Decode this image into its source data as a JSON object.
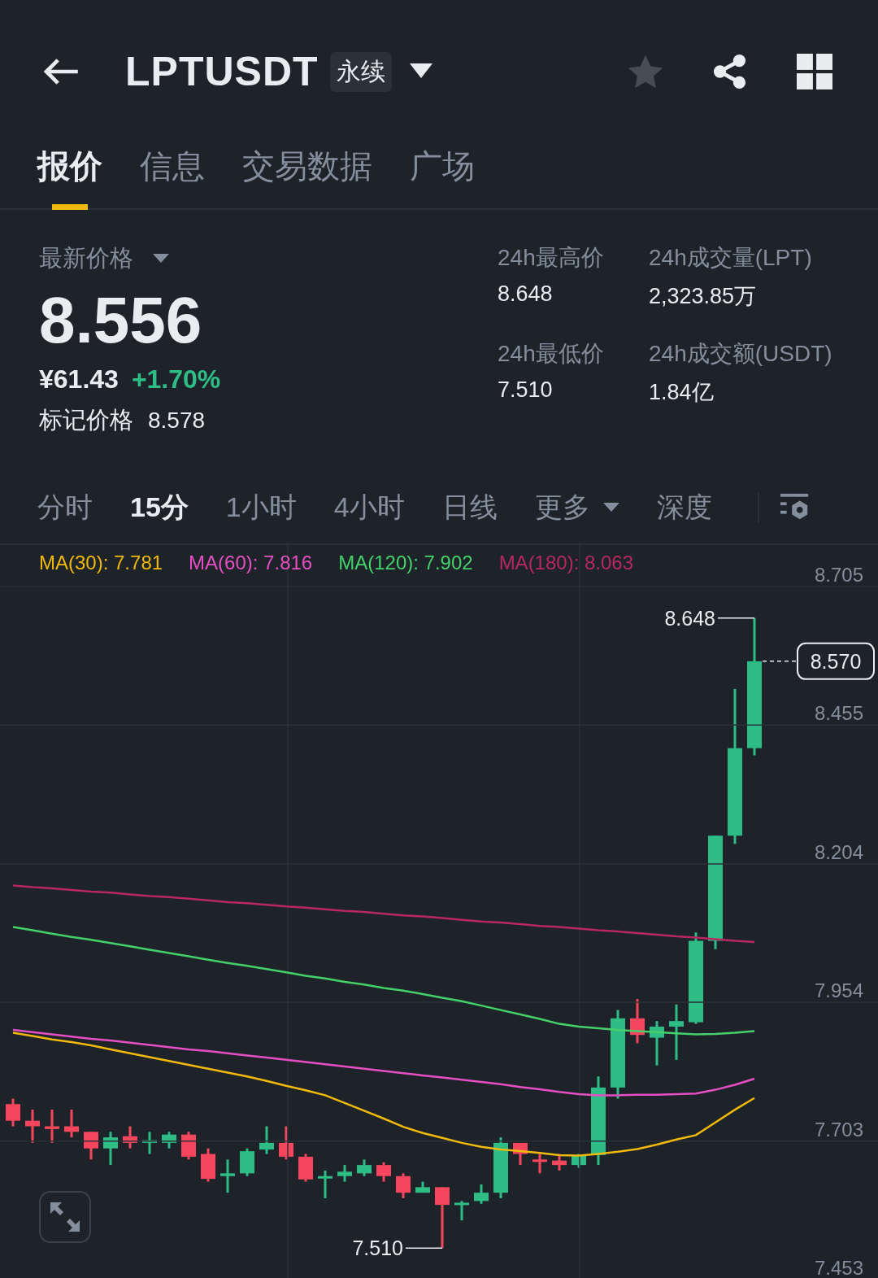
{
  "header": {
    "title": "LPTUSDT",
    "badge": "永续",
    "favorite": false
  },
  "tabs": [
    {
      "label": "报价",
      "selected": true
    },
    {
      "label": "信息",
      "selected": false
    },
    {
      "label": "交易数据",
      "selected": false
    },
    {
      "label": "广场",
      "selected": false
    }
  ],
  "price": {
    "label": "最新价格",
    "last": "8.556",
    "fiat": "¥61.43",
    "change": "+1.70%",
    "mark_label": "标记价格",
    "mark_value": "8.578"
  },
  "stats": [
    {
      "label": "24h最高价",
      "value": "8.648"
    },
    {
      "label": "24h最低价",
      "value": "7.510"
    },
    {
      "label": "24h成交量(LPT)",
      "value": "2,323.85万"
    },
    {
      "label": "24h成交额(USDT)",
      "value": "1.84亿"
    }
  ],
  "intervals": [
    {
      "label": "分时",
      "selected": false,
      "dropdown": false
    },
    {
      "label": "15分",
      "selected": true,
      "dropdown": false
    },
    {
      "label": "1小时",
      "selected": false,
      "dropdown": false
    },
    {
      "label": "4小时",
      "selected": false,
      "dropdown": false
    },
    {
      "label": "日线",
      "selected": false,
      "dropdown": false
    },
    {
      "label": "更多",
      "selected": false,
      "dropdown": true
    },
    {
      "label": "深度",
      "selected": false,
      "dropdown": false
    }
  ],
  "ma_legend": [
    {
      "value": ": 7.781"
    },
    {
      "value": ": 7.816"
    },
    {
      "value": ": 7.902"
    },
    {
      "value": ": 8.063"
    }
  ],
  "chart": {
    "chart_data": {
      "type": "line",
      "grid": true,
      "ylim": [
        7.453,
        8.705
      ],
      "yticks": [
        7.453,
        7.703,
        7.954,
        8.204,
        8.455,
        8.705
      ],
      "series": [
        {
          "name": "MA(30)",
          "color": "#f0b90b",
          "values": [
            7.899,
            7.893,
            7.887,
            7.882,
            7.876,
            7.869,
            7.862,
            7.855,
            7.848,
            7.841,
            7.834,
            7.827,
            7.82,
            7.812,
            7.803,
            7.795,
            7.786,
            7.772,
            7.758,
            7.744,
            7.729,
            7.718,
            7.709,
            7.7,
            7.693,
            7.688,
            7.685,
            7.682,
            7.678,
            7.677,
            7.68,
            7.684,
            7.689,
            7.697,
            7.706,
            7.714,
            7.737,
            7.76,
            7.781
          ]
        },
        {
          "name": "MA(60)",
          "color": "#e64fc4",
          "values": [
            7.904,
            7.9,
            7.896,
            7.892,
            7.888,
            7.885,
            7.881,
            7.877,
            7.873,
            7.869,
            7.866,
            7.862,
            7.858,
            7.854,
            7.85,
            7.846,
            7.842,
            7.838,
            7.834,
            7.83,
            7.826,
            7.822,
            7.818,
            7.814,
            7.81,
            7.806,
            7.801,
            7.797,
            7.792,
            7.788,
            7.786,
            7.786,
            7.787,
            7.787,
            7.788,
            7.789,
            7.796,
            7.805,
            7.816
          ]
        },
        {
          "name": "MA(120)",
          "color": "#45d16a",
          "values": [
            8.09,
            8.084,
            8.078,
            8.072,
            8.067,
            8.061,
            8.055,
            8.049,
            8.043,
            8.037,
            8.031,
            8.025,
            8.02,
            8.014,
            8.008,
            8.002,
            7.997,
            7.991,
            7.986,
            7.98,
            7.975,
            7.969,
            7.962,
            7.956,
            7.948,
            7.94,
            7.932,
            7.924,
            7.915,
            7.91,
            7.907,
            7.904,
            7.902,
            7.9,
            7.898,
            7.896,
            7.897,
            7.899,
            7.902
          ]
        },
        {
          "name": "MA(180)",
          "color": "#b8285e",
          "values": [
            8.165,
            8.162,
            8.16,
            8.157,
            8.154,
            8.152,
            8.149,
            8.146,
            8.144,
            8.141,
            8.138,
            8.135,
            8.133,
            8.13,
            8.127,
            8.125,
            8.122,
            8.119,
            8.117,
            8.114,
            8.111,
            8.109,
            8.106,
            8.103,
            8.1,
            8.098,
            8.095,
            8.092,
            8.09,
            8.087,
            8.084,
            8.082,
            8.079,
            8.076,
            8.073,
            8.071,
            8.068,
            8.065,
            8.063
          ]
        }
      ]
    },
    "high_label": "8.648",
    "low_label": "7.510",
    "last_label": "8.570"
  }
}
